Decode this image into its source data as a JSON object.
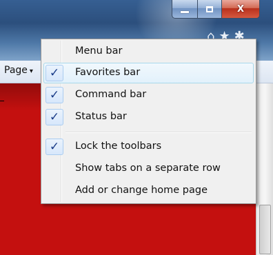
{
  "window": {
    "controls": [
      {
        "name": "minimize",
        "icon": "minimize-icon"
      },
      {
        "name": "maximize",
        "icon": "restore-icon"
      },
      {
        "name": "close",
        "icon": "close-icon"
      }
    ],
    "toolbar_icons": [
      "home-icon",
      "favorites-star-icon",
      "tools-gear-icon"
    ]
  },
  "commandbar": {
    "page_label": "Page",
    "page_caret": "▾"
  },
  "menu": {
    "items": [
      {
        "label": "Menu bar",
        "checked": false
      },
      {
        "label": "Favorites bar",
        "checked": true,
        "hover": true
      },
      {
        "label": "Command bar",
        "checked": true
      },
      {
        "label": "Status bar",
        "checked": true
      },
      {
        "separator": true
      },
      {
        "label": "Lock the toolbars",
        "checked": true
      },
      {
        "label": "Show tabs on a separate row",
        "checked": false
      },
      {
        "label": "Add or change home page",
        "checked": false
      }
    ],
    "check_glyph": "✓"
  },
  "colors": {
    "content_red": "#c4100f",
    "menu_bg": "#f0f0f0",
    "check_color": "#1a3c88",
    "close_red": "#b8301c"
  }
}
